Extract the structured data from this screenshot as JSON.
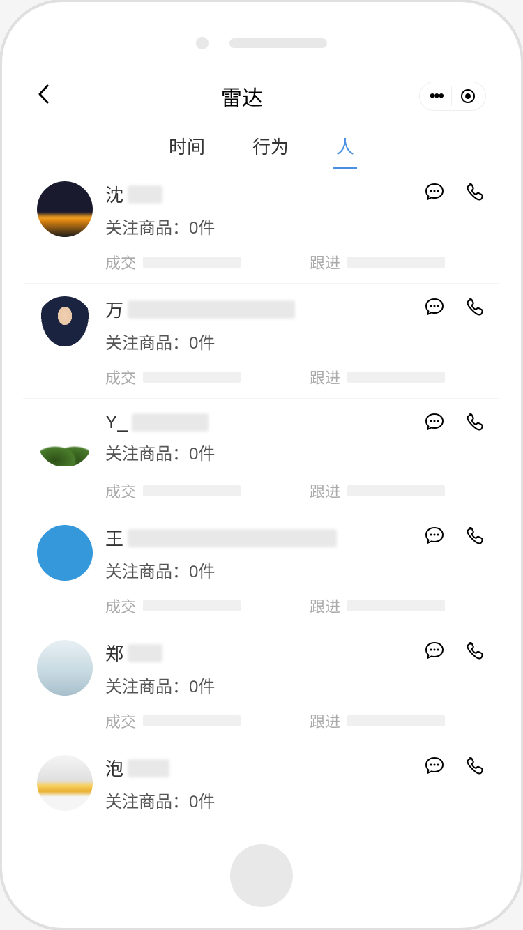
{
  "header": {
    "title": "雷达"
  },
  "tabs": [
    {
      "label": "时间",
      "active": false
    },
    {
      "label": "行为",
      "active": false
    },
    {
      "label": "人",
      "active": true
    }
  ],
  "labels": {
    "followed_prefix": "关注商品：",
    "followed_suffix": "件",
    "deal": "成交",
    "followup": "跟进"
  },
  "contacts": [
    {
      "name_prefix": "沈",
      "blur_width": 50,
      "followed_count": 0,
      "avatar_class": "avatar-1"
    },
    {
      "name_prefix": "万",
      "blur_width": 240,
      "followed_count": 0,
      "avatar_class": "avatar-2"
    },
    {
      "name_prefix": "Y_",
      "blur_width": 110,
      "followed_count": 0,
      "avatar_class": "avatar-3"
    },
    {
      "name_prefix": "王",
      "blur_width": 300,
      "followed_count": 0,
      "avatar_class": "avatar-4"
    },
    {
      "name_prefix": "郑",
      "blur_width": 50,
      "followed_count": 0,
      "avatar_class": "avatar-5"
    },
    {
      "name_prefix": "泡",
      "blur_width": 60,
      "followed_count": 0,
      "avatar_class": "avatar-6"
    }
  ]
}
